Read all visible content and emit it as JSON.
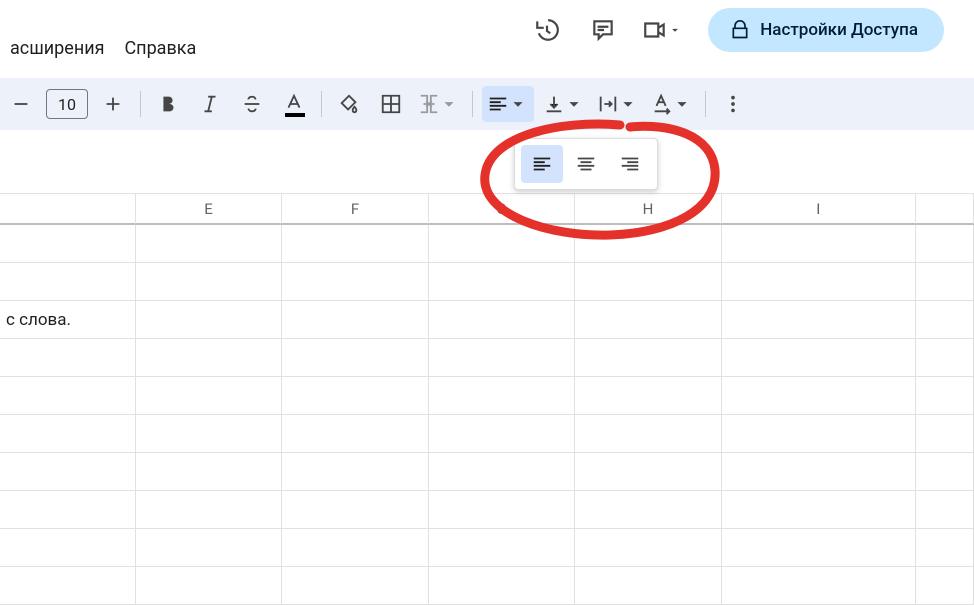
{
  "menu": {
    "extensions": "асширения",
    "help": "Справка"
  },
  "top": {
    "share_label": "Настройки Доступа"
  },
  "toolbar": {
    "font_size": "10"
  },
  "columns": [
    "",
    "E",
    "F",
    "G",
    "H",
    "I",
    ""
  ],
  "rows": [
    {
      "cells": [
        "",
        "",
        "",
        "",
        "",
        "",
        ""
      ]
    },
    {
      "cells": [
        "",
        "",
        "",
        "",
        "",
        "",
        ""
      ]
    },
    {
      "cells": [
        "с слова.",
        "",
        "",
        "",
        "",
        "",
        ""
      ]
    },
    {
      "cells": [
        "",
        "",
        "",
        "",
        "",
        "",
        ""
      ]
    },
    {
      "cells": [
        "",
        "",
        "",
        "",
        "",
        "",
        ""
      ]
    },
    {
      "cells": [
        "",
        "",
        "",
        "",
        "",
        "",
        ""
      ]
    },
    {
      "cells": [
        "",
        "",
        "",
        "",
        "",
        "",
        ""
      ]
    },
    {
      "cells": [
        "",
        "",
        "",
        "",
        "",
        "",
        ""
      ]
    },
    {
      "cells": [
        "",
        "",
        "",
        "",
        "",
        "",
        ""
      ]
    },
    {
      "cells": [
        "",
        "",
        "",
        "",
        "",
        "",
        ""
      ]
    }
  ]
}
